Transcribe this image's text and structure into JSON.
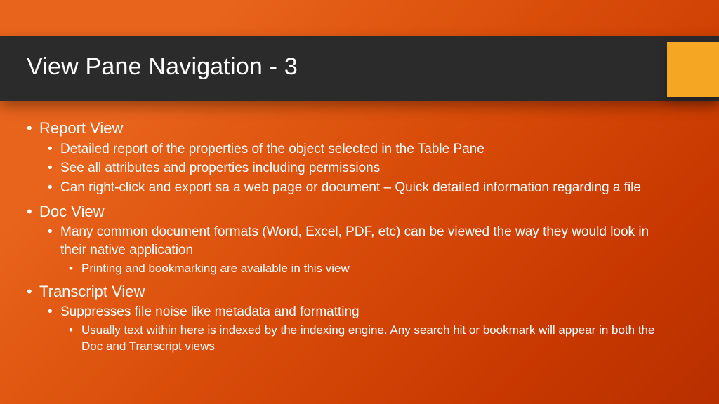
{
  "slide": {
    "title": "View Pane Navigation - 3",
    "sections": [
      {
        "heading": "Report View",
        "points": [
          {
            "text": "Detailed report of the properties of the object selected in the Table Pane"
          },
          {
            "text": "See all attributes and properties including permissions"
          },
          {
            "text": "Can right-click and export sa a web page or document – Quick detailed information regarding a file"
          }
        ]
      },
      {
        "heading": "Doc View",
        "points": [
          {
            "text": "Many common document formats (Word, Excel, PDF, etc) can be viewed the way they would look in their native application",
            "subpoints": [
              {
                "text": "Printing and bookmarking are available in this view"
              }
            ]
          }
        ]
      },
      {
        "heading": "Transcript View",
        "points": [
          {
            "text": "Suppresses file noise like metadata and formatting",
            "subpoints": [
              {
                "text": "Usually text within here is indexed by the indexing engine. Any search hit or bookmark will appear in both the Doc and Transcript views"
              }
            ]
          }
        ]
      }
    ]
  }
}
